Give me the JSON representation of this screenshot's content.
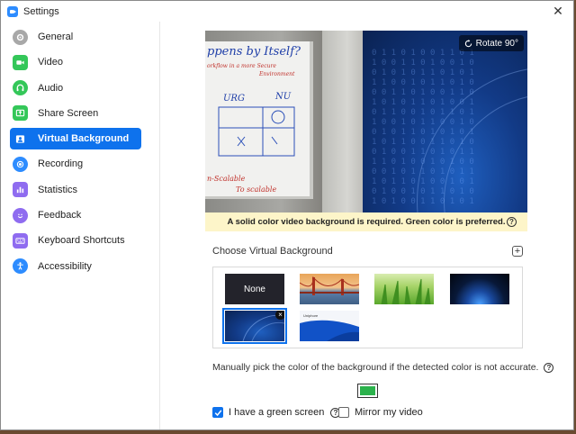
{
  "window": {
    "title": "Settings",
    "close_glyph": "✕"
  },
  "sidebar": {
    "items": [
      {
        "label": "General",
        "icon": "gear-icon",
        "color": "#a8a8a8"
      },
      {
        "label": "Video",
        "icon": "video-camera-icon",
        "color": "#34c759"
      },
      {
        "label": "Audio",
        "icon": "headphones-icon",
        "color": "#34c759"
      },
      {
        "label": "Share Screen",
        "icon": "share-screen-icon",
        "color": "#34c759"
      },
      {
        "label": "Virtual Background",
        "icon": "portrait-icon",
        "color": "#0e72ed",
        "active": true
      },
      {
        "label": "Recording",
        "icon": "record-icon",
        "color": "#2d8cff"
      },
      {
        "label": "Statistics",
        "icon": "statistics-icon",
        "color": "#8f6cf0"
      },
      {
        "label": "Feedback",
        "icon": "smiley-icon",
        "color": "#8f6cf0"
      },
      {
        "label": "Keyboard Shortcuts",
        "icon": "keyboard-icon",
        "color": "#8f6cf0"
      },
      {
        "label": "Accessibility",
        "icon": "accessibility-icon",
        "color": "#2d8cff"
      }
    ]
  },
  "preview": {
    "rotate_label": "Rotate 90°",
    "whiteboard_text": {
      "line1": "ppens  by Itself?",
      "line2": "orkflow in a more Secure",
      "line3": "Environment",
      "urg": "URG",
      "nu": "NU",
      "scalable": "n-Scalable",
      "to_scalable": "To scalable"
    }
  },
  "warning": {
    "text": "A solid color video background is required. Green color is preferred."
  },
  "choose": {
    "label": "Choose Virtual Background",
    "add_glyph": "+"
  },
  "gallery": {
    "none_label": "None",
    "remove_glyph": "×",
    "wave_brand": "Uniphore"
  },
  "manual": {
    "text": "Manually pick the color of the background if the detected color is not accurate.",
    "picked_color": "#2bb24c"
  },
  "options": {
    "green_screen_label": "I have a green screen",
    "green_screen_checked": true,
    "mirror_label": "Mirror my video",
    "mirror_checked": false
  },
  "colors": {
    "accent": "#0e72ed",
    "warning_bg": "#fdf5c9"
  }
}
